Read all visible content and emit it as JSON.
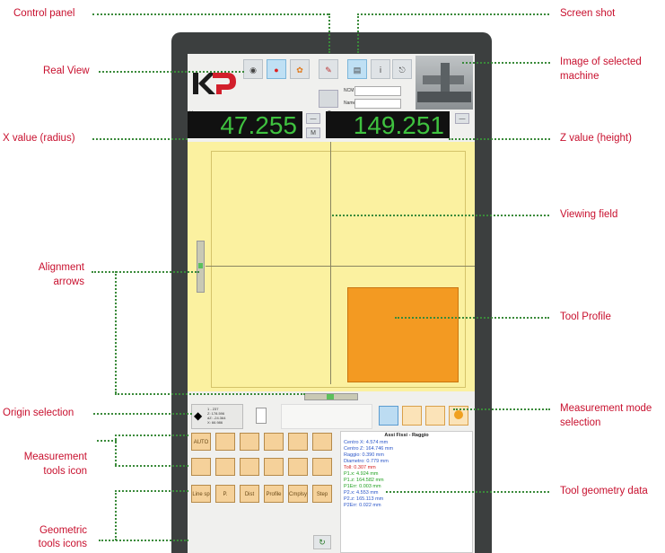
{
  "callouts": {
    "control_panel": "Control panel",
    "screen_shot": "Screen shot",
    "real_view": "Real View",
    "image_selected_machine_1": "Image of selected",
    "image_selected_machine_2": "machine",
    "x_value": "X value (radius)",
    "z_value": "Z value (height)",
    "viewing_field": "Viewing field",
    "alignment_arrows_1": "Alignment",
    "alignment_arrows_2": "arrows",
    "tool_profile": "Tool Profile",
    "origin_selection": "Origin selection",
    "measurement_mode_1": "Measurement mode",
    "measurement_mode_2": "selection",
    "measurement_tools_1": "Measurement",
    "measurement_tools_2": "tools icon",
    "tool_geometry_data": "Tool geometry data",
    "geometric_tools_1": "Geometric",
    "geometric_tools_2": "tools icons"
  },
  "screen": {
    "logo": "KP",
    "x_label": "Xr",
    "z_label": "Z",
    "x_value": "47.255",
    "z_value": "149.251",
    "data_title": "Assi Fissi - Raggio",
    "data_lines": [
      {
        "text": "Centro X: 4.574 mm",
        "color": "#2a55c8"
      },
      {
        "text": "Centro Z: 164.746 mm",
        "color": "#2a55c8"
      },
      {
        "text": "Raggio: 0.390 mm",
        "color": "#2a55c8"
      },
      {
        "text": "Diametro: 0.779 mm",
        "color": "#2a55c8"
      },
      {
        "text": "Toll: 0.307 mm",
        "color": "#d62020"
      },
      {
        "text": "P1.x: 4.924 mm",
        "color": "#20a020"
      },
      {
        "text": "P1.z: 164.582 mm",
        "color": "#20a020"
      },
      {
        "text": "P1Err: 0.003 mm",
        "color": "#20a020"
      },
      {
        "text": "P2.x: 4.553 mm",
        "color": "#2a55c8"
      },
      {
        "text": "P2.z: 165.113 mm",
        "color": "#2a55c8"
      },
      {
        "text": "P2Err: 0.022 mm",
        "color": "#2a55c8"
      }
    ],
    "origin_lines": [
      "1 - 237",
      "Z: 178.596",
      "dZ: -24.364",
      "X: 66.986"
    ],
    "ncm_label": "NCM",
    "name_label": "Name",
    "tools_row1": [
      "AUTO",
      "",
      "",
      "",
      "",
      ""
    ],
    "tools_row2": [
      "",
      "",
      "",
      "",
      "",
      ""
    ],
    "tools_row3": [
      "Line sp",
      "P.",
      "Dist",
      "Profile",
      "Cmplsy",
      "Step"
    ]
  },
  "colors": {
    "callout_text": "#c8102e",
    "leader": "#3a8a3a",
    "readout": "#3fc23f",
    "tool_profile": "#f39a22"
  }
}
